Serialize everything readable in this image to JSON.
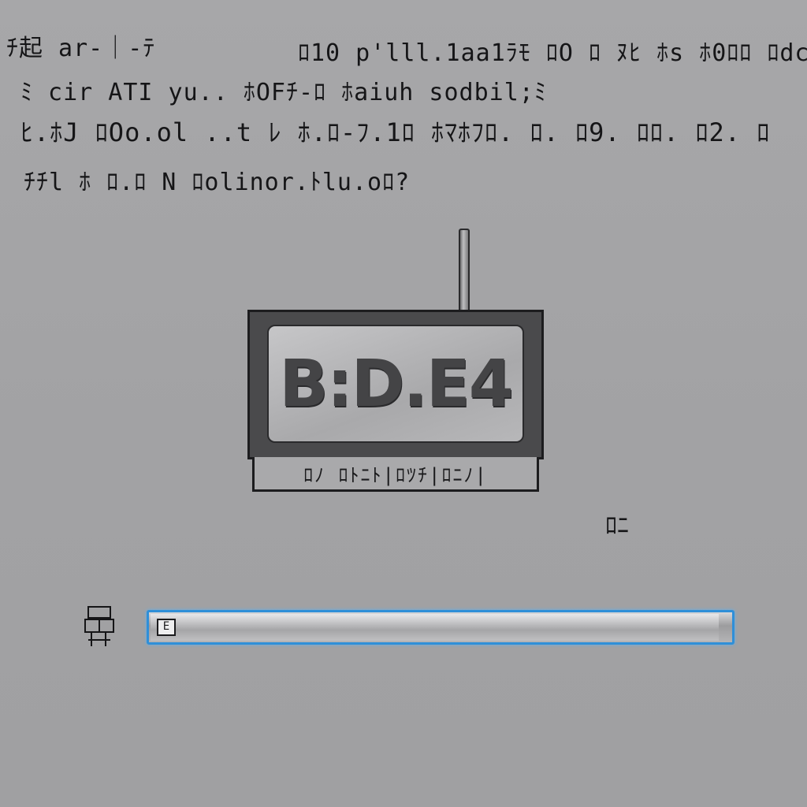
{
  "header": {
    "line1_left": "ﾁ起 ar-｜-ﾃ",
    "line1_right": "ﾛ10 p'lll.1aa1ﾗﾓ ﾛO ﾛ ﾇﾋ ﾎs ﾎ0ﾛﾛ ﾛdc",
    "line2": "ﾐ cir ATI yu.. ﾎOFﾁ-ﾛ ﾎaiuh sodbil;ﾐ",
    "line3": "ﾋ.ﾎJ ﾛOo.ol ..t ﾚ ﾎ.ﾛ-ﾌ.1ﾛ ﾎﾏﾎﾌﾛ. ﾛ. ﾛ9. ﾛﾛ. ﾛ2. ﾛ",
    "line4": "ﾁﾁl ﾎ ﾛ.ﾛ N ﾛolinor.ﾄlu.oﾛ?"
  },
  "device": {
    "readout": "B:D.E4",
    "base_label": "ﾛﾉ ﾛﾄﾆﾄ|ﾛﾂﾁ|ﾛﾆﾉ|"
  },
  "corner_mark": "ﾛﾆ",
  "field": {
    "icon": "field-icon",
    "badge_text": "E",
    "progress": 0.98
  },
  "colors": {
    "background": "#a3a3a5",
    "field_border": "#2f8fd8",
    "text": "#151517"
  }
}
